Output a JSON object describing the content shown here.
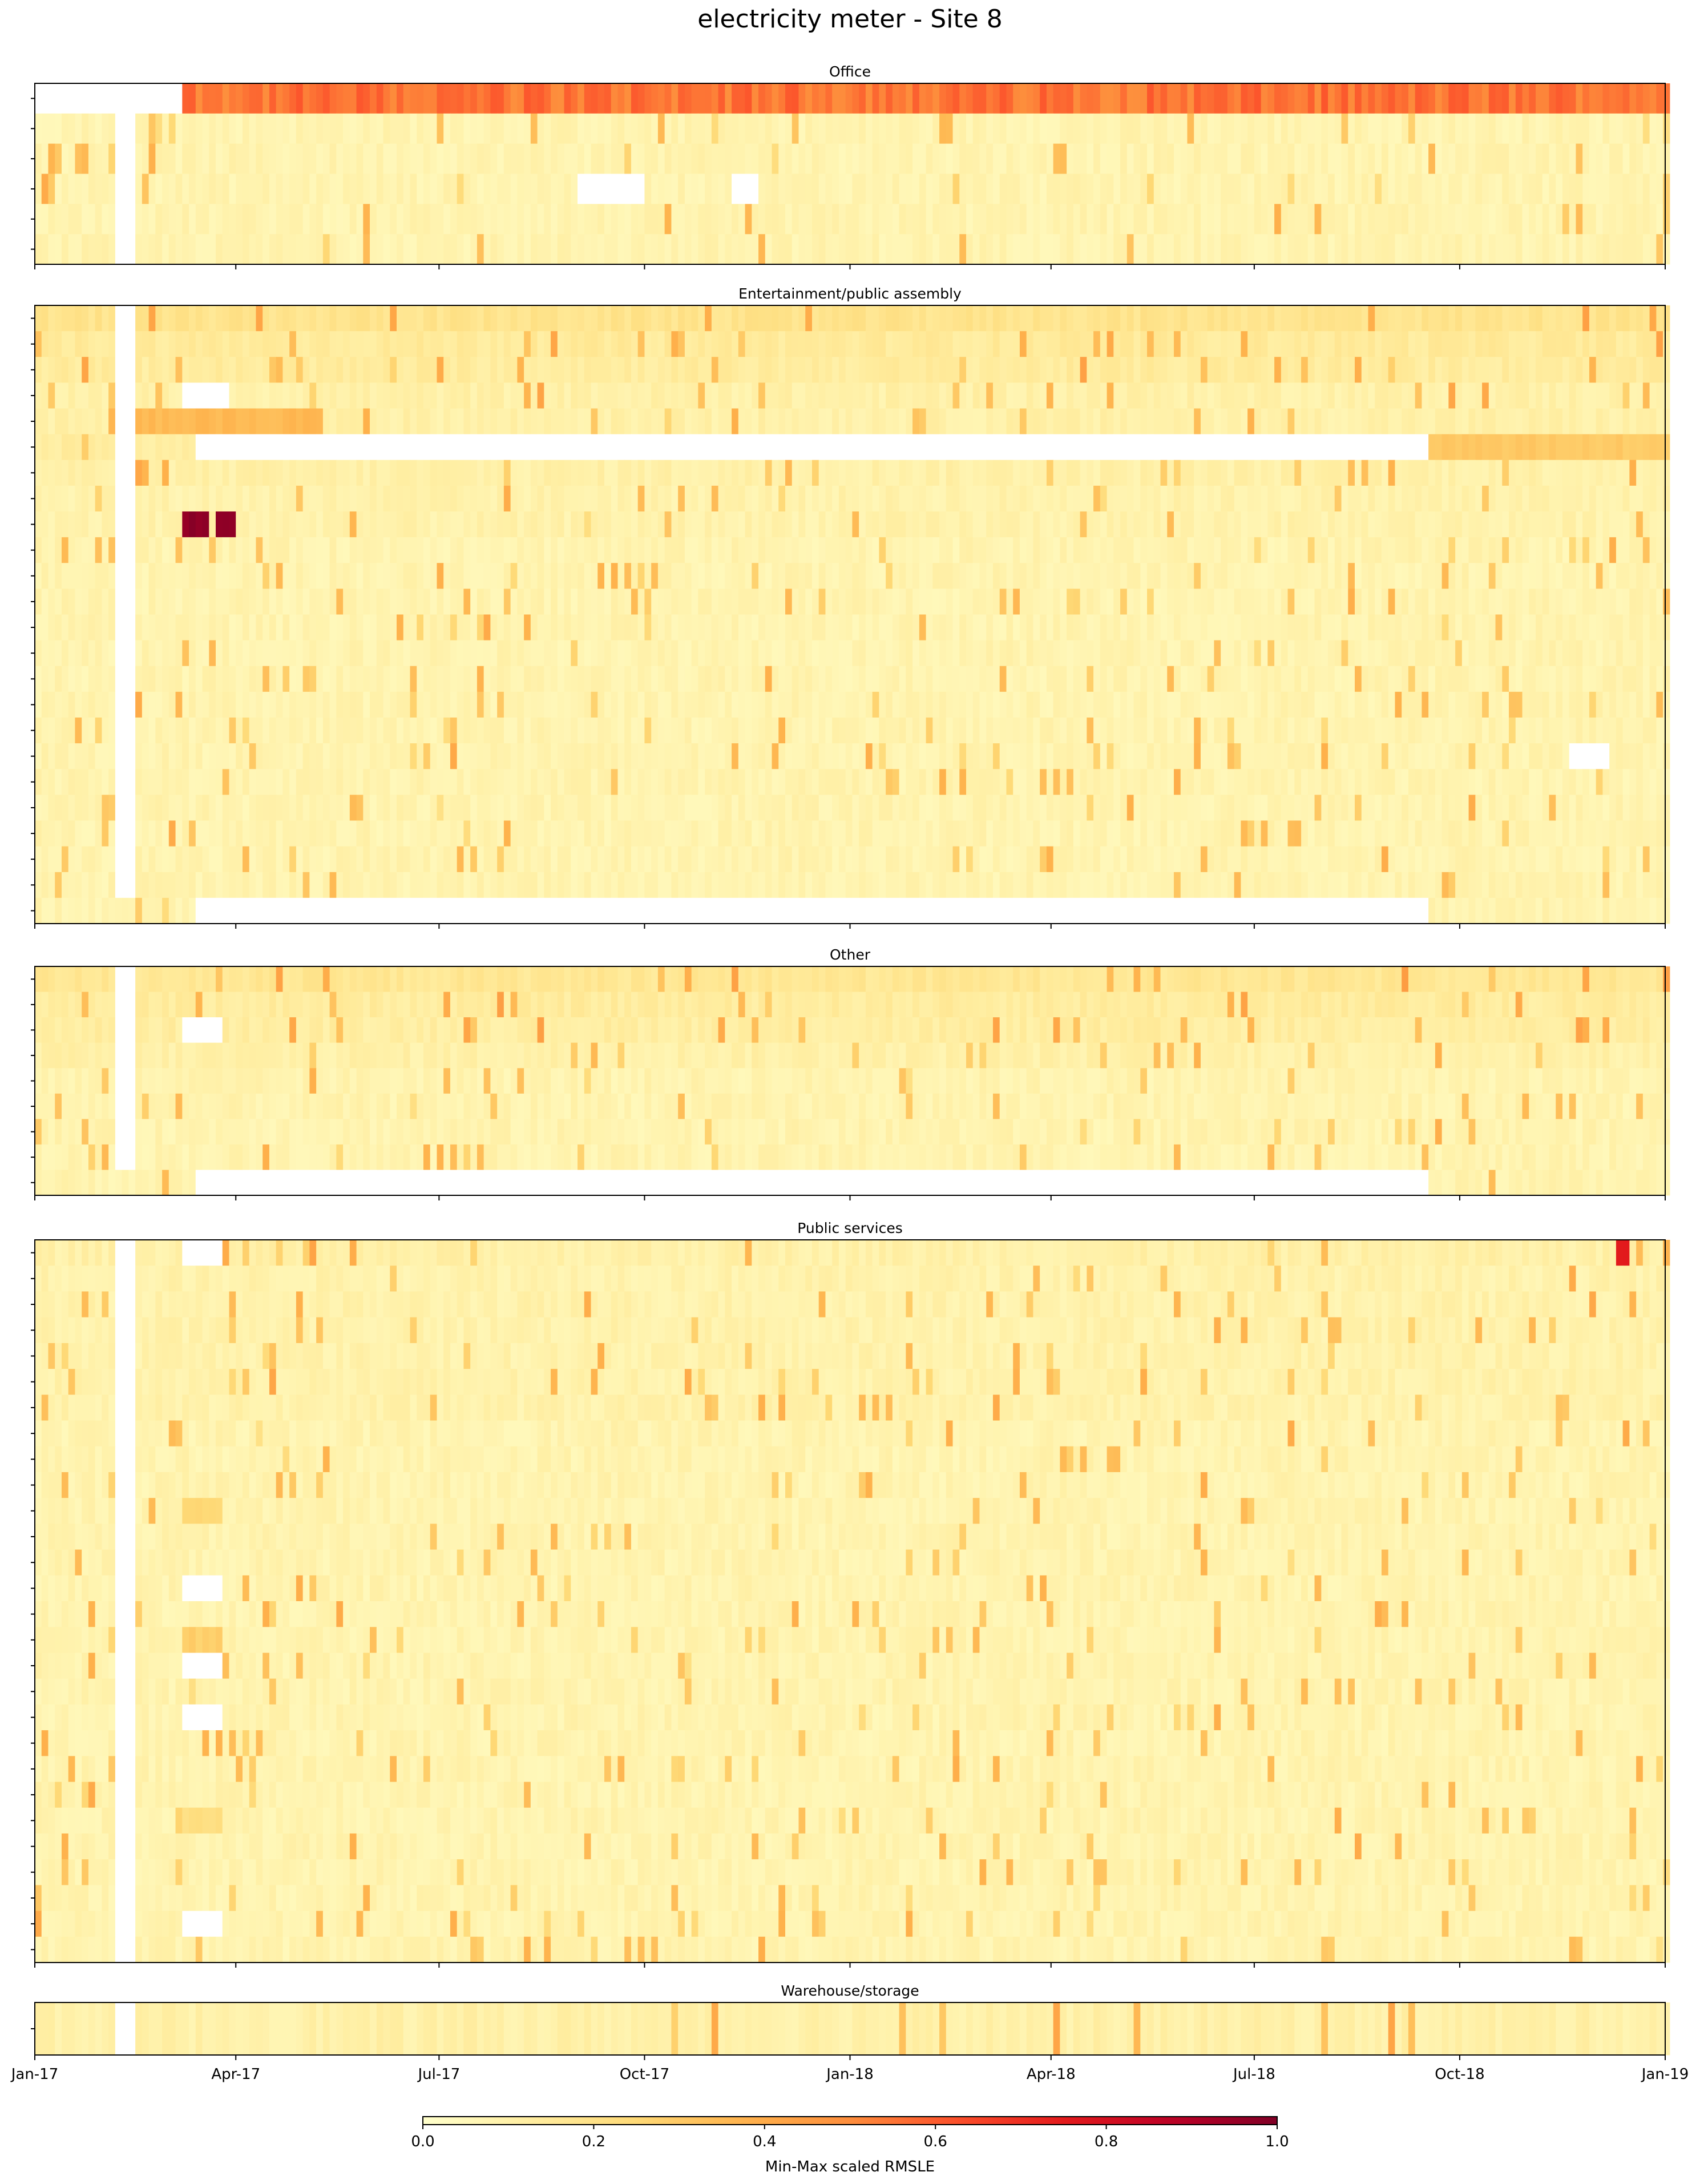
{
  "chart_data": {
    "type": "heatmap",
    "title": "electricity meter - Site 8",
    "colormap": "YlOrRd",
    "x_range": [
      "2017-01-01",
      "2019-01-01"
    ],
    "x_ticks": [
      "Jan-17",
      "Apr-17",
      "Jul-17",
      "Oct-17",
      "Jan-18",
      "Apr-18",
      "Jul-18",
      "Oct-18",
      "Jan-19"
    ],
    "colorbar": {
      "label": "Min-Max scaled RMSLE",
      "range": [
        0.0,
        1.0
      ],
      "ticks": [
        "0.0",
        "0.2",
        "0.4",
        "0.6",
        "0.8",
        "1.0"
      ]
    },
    "panels": [
      {
        "name": "Office",
        "meter_rows": 6,
        "base_level": 0.07,
        "row_levels": [
          0.55,
          0.08,
          0.08,
          0.08,
          0.08,
          0.08
        ],
        "missing": [
          {
            "rows": [
              0,
              5
            ],
            "from": "2017-02-06",
            "to": "2017-02-13"
          },
          {
            "rows": [
              0,
              0
            ],
            "from": "2017-01-01",
            "to": "2017-03-08"
          },
          {
            "rows": [
              3,
              3
            ],
            "from": "2017-09-01",
            "to": "2017-09-30"
          },
          {
            "rows": [
              3,
              3
            ],
            "from": "2017-11-08",
            "to": "2017-11-20"
          }
        ],
        "hot_spots": []
      },
      {
        "name": "Entertainment/public assembly",
        "meter_rows": 24,
        "base_level": 0.08,
        "row_levels": [
          0.18,
          0.14,
          0.13,
          0.1,
          0.1,
          0.12,
          0.1,
          0.09,
          0.09,
          0.08,
          0.08,
          0.08,
          0.08,
          0.08,
          0.08,
          0.08,
          0.08,
          0.08,
          0.08,
          0.08,
          0.08,
          0.08,
          0.08,
          0.08
        ],
        "missing": [
          {
            "rows": [
              0,
              22
            ],
            "from": "2017-02-06",
            "to": "2017-02-13"
          },
          {
            "rows": [
              3,
              3
            ],
            "from": "2017-03-08",
            "to": "2017-03-28"
          },
          {
            "rows": [
              5,
              5
            ],
            "from": "2017-03-14",
            "to": "2018-09-15"
          },
          {
            "rows": [
              23,
              23
            ],
            "from": "2017-03-14",
            "to": "2018-09-15"
          },
          {
            "rows": [
              17,
              17
            ],
            "from": "2018-11-20",
            "to": "2018-12-05"
          }
        ],
        "hot_spots": [
          {
            "rows": [
              4,
              4
            ],
            "from": "2017-02-01",
            "to": "2017-05-10",
            "level": 0.35
          },
          {
            "rows": [
              5,
              5
            ],
            "from": "2018-09-15",
            "to": "2019-01-01",
            "level": 0.3
          },
          {
            "rows": [
              8,
              8
            ],
            "from": "2017-03-08",
            "to": "2017-03-20",
            "level": 0.97
          },
          {
            "rows": [
              8,
              8
            ],
            "from": "2017-03-21",
            "to": "2017-03-31",
            "level": 0.97
          }
        ]
      },
      {
        "name": "Other",
        "meter_rows": 9,
        "base_level": 0.08,
        "row_levels": [
          0.16,
          0.13,
          0.12,
          0.1,
          0.08,
          0.08,
          0.08,
          0.08,
          0.08
        ],
        "missing": [
          {
            "rows": [
              0,
              7
            ],
            "from": "2017-02-06",
            "to": "2017-02-13"
          },
          {
            "rows": [
              2,
              2
            ],
            "from": "2017-03-08",
            "to": "2017-03-25"
          },
          {
            "rows": [
              8,
              8
            ],
            "from": "2017-03-14",
            "to": "2018-09-15"
          }
        ],
        "hot_spots": []
      },
      {
        "name": "Public services",
        "meter_rows": 28,
        "base_level": 0.08,
        "row_levels": [
          0.1,
          0.09,
          0.09,
          0.09,
          0.09,
          0.09,
          0.09,
          0.08,
          0.08,
          0.08,
          0.08,
          0.08,
          0.08,
          0.08,
          0.08,
          0.08,
          0.08,
          0.08,
          0.08,
          0.08,
          0.08,
          0.08,
          0.08,
          0.08,
          0.08,
          0.08,
          0.08,
          0.08
        ],
        "missing": [
          {
            "rows": [
              0,
              27
            ],
            "from": "2017-02-06",
            "to": "2017-02-13"
          },
          {
            "rows": [
              0,
              0
            ],
            "from": "2017-03-08",
            "to": "2017-03-25"
          },
          {
            "rows": [
              13,
              13
            ],
            "from": "2017-03-08",
            "to": "2017-03-25"
          },
          {
            "rows": [
              16,
              16
            ],
            "from": "2017-03-08",
            "to": "2017-03-25"
          },
          {
            "rows": [
              18,
              18
            ],
            "from": "2017-03-08",
            "to": "2017-03-25"
          },
          {
            "rows": [
              26,
              26
            ],
            "from": "2017-03-08",
            "to": "2017-03-25"
          }
        ],
        "hot_spots": [
          {
            "rows": [
              10,
              10
            ],
            "from": "2017-03-08",
            "to": "2017-03-25",
            "level": 0.25
          },
          {
            "rows": [
              15,
              15
            ],
            "from": "2017-03-08",
            "to": "2017-03-25",
            "level": 0.28
          },
          {
            "rows": [
              22,
              22
            ],
            "from": "2017-03-08",
            "to": "2017-03-25",
            "level": 0.22
          },
          {
            "rows": [
              0,
              0
            ],
            "from": "2018-12-10",
            "to": "2018-12-14",
            "level": 0.75
          }
        ]
      },
      {
        "name": "Warehouse/storage",
        "meter_rows": 1,
        "base_level": 0.1,
        "row_levels": [
          0.1
        ],
        "missing": [
          {
            "rows": [
              0,
              0
            ],
            "from": "2017-02-06",
            "to": "2017-02-13"
          }
        ],
        "hot_spots": []
      }
    ]
  }
}
